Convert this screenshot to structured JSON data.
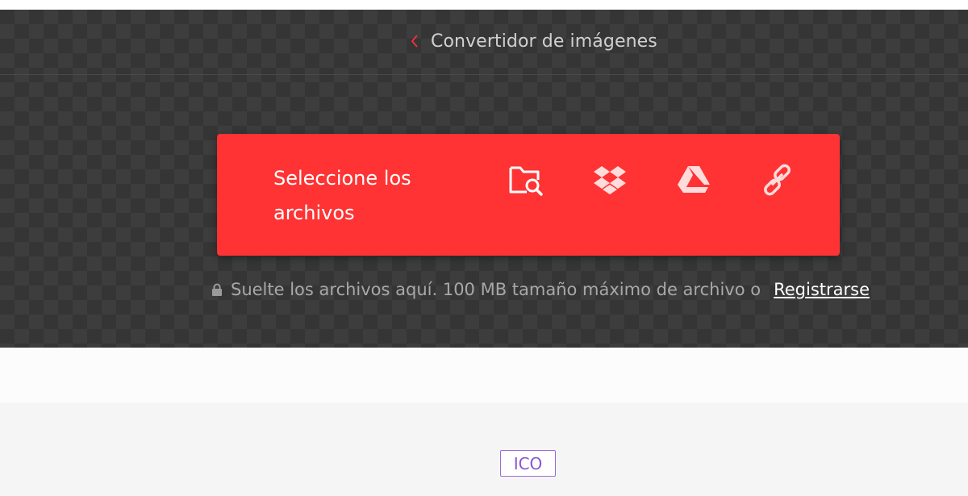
{
  "header": {
    "back_icon": "chevron-left-icon",
    "title": "Convertidor de imágenes"
  },
  "upload": {
    "select_label": "Seleccione los archivos",
    "sources": [
      {
        "icon": "folder-search-icon"
      },
      {
        "icon": "dropbox-icon"
      },
      {
        "icon": "google-drive-icon"
      },
      {
        "icon": "link-icon"
      }
    ],
    "accent_color": "#ff3333"
  },
  "note": {
    "icon": "lock-icon",
    "text": "Suelte los archivos aquí. 100 MB tamaño máximo de archivo o",
    "link_label": "Registrarse"
  },
  "formats": {
    "badge_label": "ICO",
    "badge_color": "#8a55cf"
  }
}
